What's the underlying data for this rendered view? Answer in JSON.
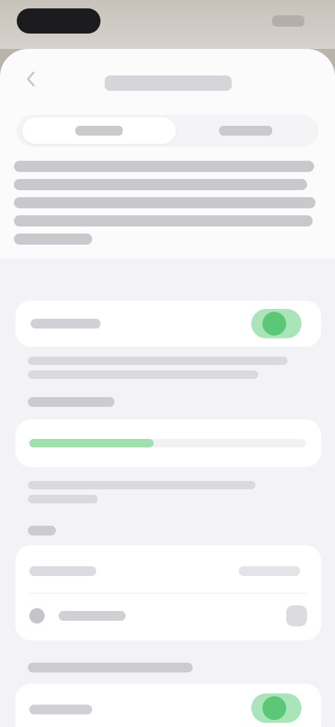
{
  "screen": {
    "title": "",
    "back_icon": "chevron-left-icon"
  },
  "tabs": [
    {
      "label": "",
      "active": true
    },
    {
      "label": "",
      "active": false
    }
  ],
  "description": "",
  "card_main_toggle": {
    "label": "",
    "enabled": true,
    "accent_color": "#5cc877"
  },
  "caption_1": "",
  "section_1": {
    "header": "",
    "progress_fraction": 0.45,
    "progress_color": "#9fe0ae"
  },
  "caption_2": "",
  "section_2": {
    "header": "",
    "rows": [
      {
        "label": "",
        "value": ""
      },
      {
        "label": "",
        "icon": "person-icon",
        "trailing_icon": "chevron-right-icon"
      }
    ]
  },
  "section_3": {
    "header": "",
    "toggle_label": "",
    "enabled": true
  }
}
